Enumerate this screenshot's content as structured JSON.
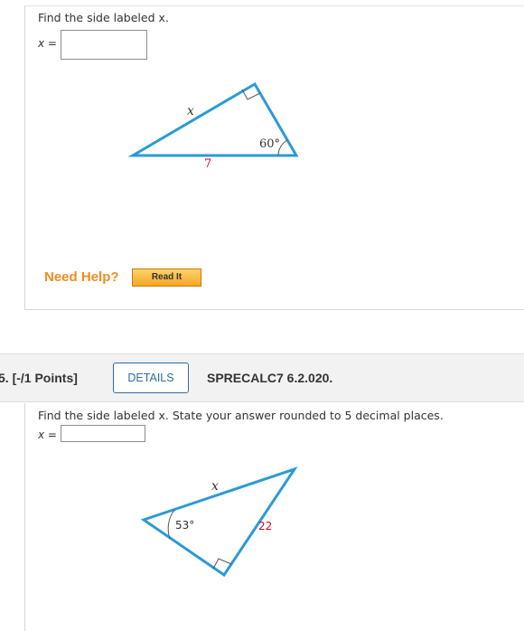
{
  "q4": {
    "prompt": "Find the side labeled x.",
    "answer_prefix": "x =",
    "answer_value": "",
    "figure": {
      "side_top": "x",
      "angle": "60°",
      "side_bottom": "7"
    },
    "need_help": "Need Help?",
    "read_it": "Read It"
  },
  "q5": {
    "number": "5.  [-/1 Points]",
    "details": "DETAILS",
    "code": "SPRECALC7 6.2.020.",
    "prompt": "Find the side labeled x. State your answer rounded to 5 decimal places.",
    "answer_prefix": "x =",
    "answer_value": "",
    "figure": {
      "side_top": "x",
      "angle": "53°",
      "side_right": "22"
    }
  },
  "colors": {
    "triangle": "#2b9ad8",
    "label_red": "#d0021b",
    "help_orange": "#f28c1e",
    "details_blue": "#2e6da4"
  }
}
